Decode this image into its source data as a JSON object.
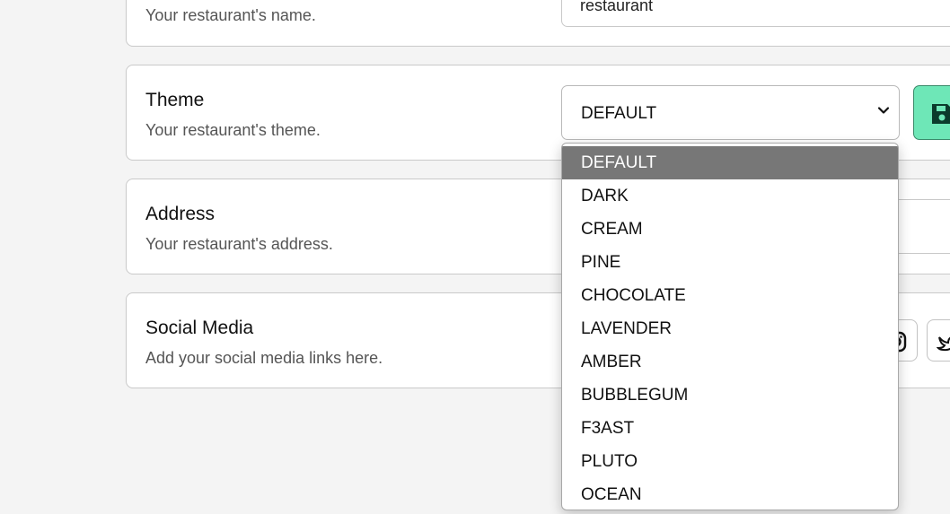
{
  "colors": {
    "background": "#f4f4f4",
    "card": "#ffffff",
    "save_button": "#6ee7b7",
    "option_highlight": "#777777"
  },
  "name_section": {
    "subtitle": "Your restaurant's name.",
    "input_value": "restaurant"
  },
  "theme_section": {
    "title": "Theme",
    "subtitle": "Your restaurant's theme.",
    "selected_value": "DEFAULT",
    "save_icon": "floppy-disk-icon",
    "dropdown_icon": "chevron-down-icon"
  },
  "address_section": {
    "title": "Address",
    "subtitle": "Your restaurant's address."
  },
  "social_section": {
    "title": "Social Media",
    "subtitle": "Add your social media links here.",
    "icons": [
      "instagram-icon",
      "twitter-icon"
    ]
  },
  "theme_options": {
    "highlighted": "DEFAULT",
    "items": [
      "DEFAULT",
      "DARK",
      "CREAM",
      "PINE",
      "CHOCOLATE",
      "LAVENDER",
      "AMBER",
      "BUBBLEGUM",
      "F3AST",
      "PLUTO",
      "OCEAN"
    ]
  }
}
